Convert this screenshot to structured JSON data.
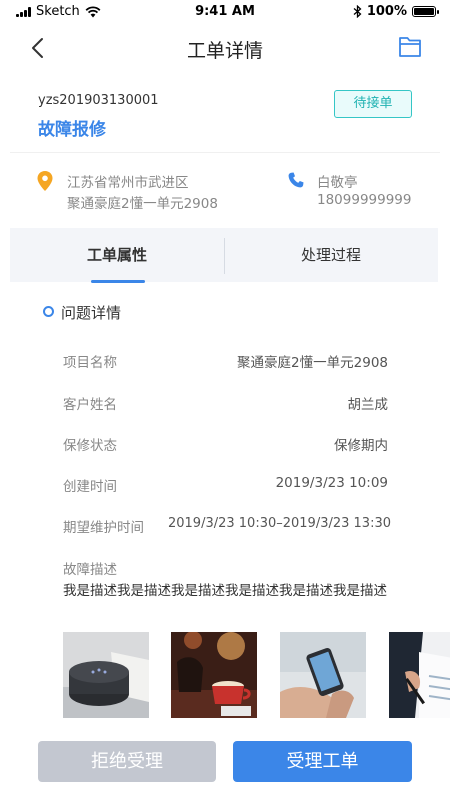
{
  "status_bar": {
    "carrier": "Sketch",
    "time": "9:41 AM",
    "battery": "100%"
  },
  "nav": {
    "title": "工单详情",
    "back_icon": "chevron-left-icon",
    "action_icon": "folder-icon"
  },
  "order": {
    "id": "yzs201903130001",
    "type": "故障报修",
    "status": "待接单"
  },
  "address": {
    "line1": "江苏省常州市武进区",
    "line2": "聚通豪庭2懂一单元2908",
    "icon": "location-pin-icon"
  },
  "contact": {
    "name": "白敬亭",
    "phone": "18099999999",
    "icon": "phone-icon"
  },
  "tabs": [
    {
      "label": "工单属性",
      "active": true
    },
    {
      "label": "处理过程",
      "active": false
    }
  ],
  "details": {
    "section_title": "问题详情",
    "rows": [
      {
        "label": "项目名称",
        "value": "聚通豪庭2懂一单元2908"
      },
      {
        "label": "客户姓名",
        "value": "胡兰成"
      },
      {
        "label": "保修状态",
        "value": "保修期内"
      },
      {
        "label": "创建时间",
        "value": "2019/3/23 10:09"
      },
      {
        "label": "期望维护时间",
        "value": "2019/3/23 10:30–2019/3/23 13:30"
      }
    ],
    "description_label": "故障描述",
    "description": "我是描述我是描述我是描述我是描述我是描述我是描述"
  },
  "photos": [
    "smart-speaker-photo",
    "latte-cafe-photo",
    "phone-in-hand-photo",
    "business-desk-photo"
  ],
  "actions": {
    "reject": "拒绝受理",
    "accept": "受理工单"
  },
  "colors": {
    "accent": "#3b86e8",
    "status_teal": "#20b2b2",
    "disabled_button": "#c3c7d0"
  }
}
